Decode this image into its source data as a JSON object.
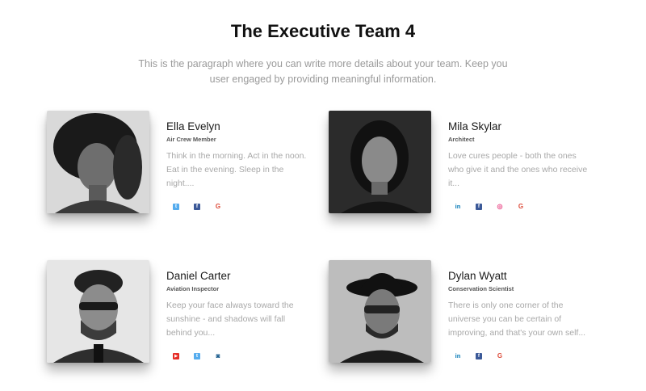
{
  "title": "The Executive Team 4",
  "intro": "This is the paragraph where you can write more details about your team. Keep you user engaged by providing meaningful information.",
  "members": [
    {
      "name": "Ella Evelyn",
      "role": "Air Crew Member",
      "bio": "Think in the morning. Act in the noon. Eat in the evening. Sleep in the night....",
      "socials": [
        {
          "icon": "twitter-icon",
          "glyph": "t",
          "color": "#55acee"
        },
        {
          "icon": "facebook-icon",
          "glyph": "f",
          "color": "#3b5998"
        },
        {
          "icon": "google-icon",
          "glyph": "G",
          "color": "#dd4b39"
        }
      ]
    },
    {
      "name": "Mila Skylar",
      "role": "Architect",
      "bio": "Love cures people - both the ones who give it and the ones who receive it...",
      "socials": [
        {
          "icon": "linkedin-icon",
          "glyph": "in",
          "color": "#0077b5"
        },
        {
          "icon": "facebook-icon",
          "glyph": "f",
          "color": "#3b5998"
        },
        {
          "icon": "dribbble-icon",
          "glyph": "◎",
          "color": "#ea4c89"
        },
        {
          "icon": "google-icon",
          "glyph": "G",
          "color": "#dd4b39"
        }
      ]
    },
    {
      "name": "Daniel Carter",
      "role": "Aviation Inspector",
      "bio": "Keep your face always toward the sunshine - and shadows will fall behind you...",
      "socials": [
        {
          "icon": "youtube-icon",
          "glyph": "▶",
          "color": "#e52d27"
        },
        {
          "icon": "twitter-icon",
          "glyph": "t",
          "color": "#55acee"
        },
        {
          "icon": "instagram-icon",
          "glyph": "◙",
          "color": "#125688"
        }
      ]
    },
    {
      "name": "Dylan Wyatt",
      "role": "Conservation Scientist",
      "bio": "There is only one corner of the universe you can be certain of improving, and that's your own self...",
      "socials": [
        {
          "icon": "linkedin-icon",
          "glyph": "in",
          "color": "#0077b5"
        },
        {
          "icon": "facebook-icon",
          "glyph": "f",
          "color": "#3b5998"
        },
        {
          "icon": "google-icon",
          "glyph": "G",
          "color": "#dd4b39"
        }
      ]
    }
  ]
}
